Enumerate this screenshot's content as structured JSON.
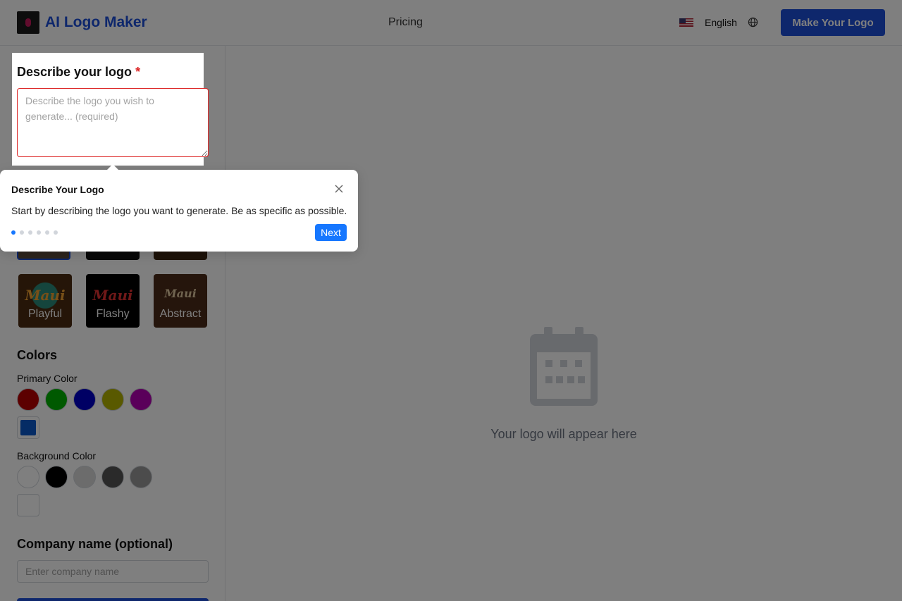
{
  "header": {
    "brand": "AI Logo Maker",
    "nav_pricing": "Pricing",
    "language": "English",
    "cta": "Make Your Logo"
  },
  "sidebar": {
    "describe_title": "Describe your logo",
    "required_mark": "*",
    "describe_placeholder": "Describe the logo you wish to generate... (required)",
    "styles": [
      {
        "label": "Playful",
        "art": "Maui"
      },
      {
        "label": "Flashy",
        "art": "Maui"
      },
      {
        "label": "Abstract",
        "art": "Maui"
      }
    ],
    "colors_title": "Colors",
    "primary_label": "Primary Color",
    "primary_colors": [
      "#b90000",
      "#00b300",
      "#0000c8",
      "#b3b300",
      "#b400b4"
    ],
    "primary_custom": "#0a58ca",
    "background_label": "Background Color",
    "background_colors": [
      "#ffffff",
      "#000000",
      "#d9d9d9",
      "#555555",
      "#999999"
    ],
    "company_title": "Company name (optional)",
    "company_placeholder": "Enter company name"
  },
  "preview": {
    "empty_text": "Your logo will appear here"
  },
  "tour": {
    "title": "Describe Your Logo",
    "body": "Start by describing the logo you want to generate. Be as specific as possible.",
    "step": 1,
    "total_steps": 6,
    "next_label": "Next"
  }
}
